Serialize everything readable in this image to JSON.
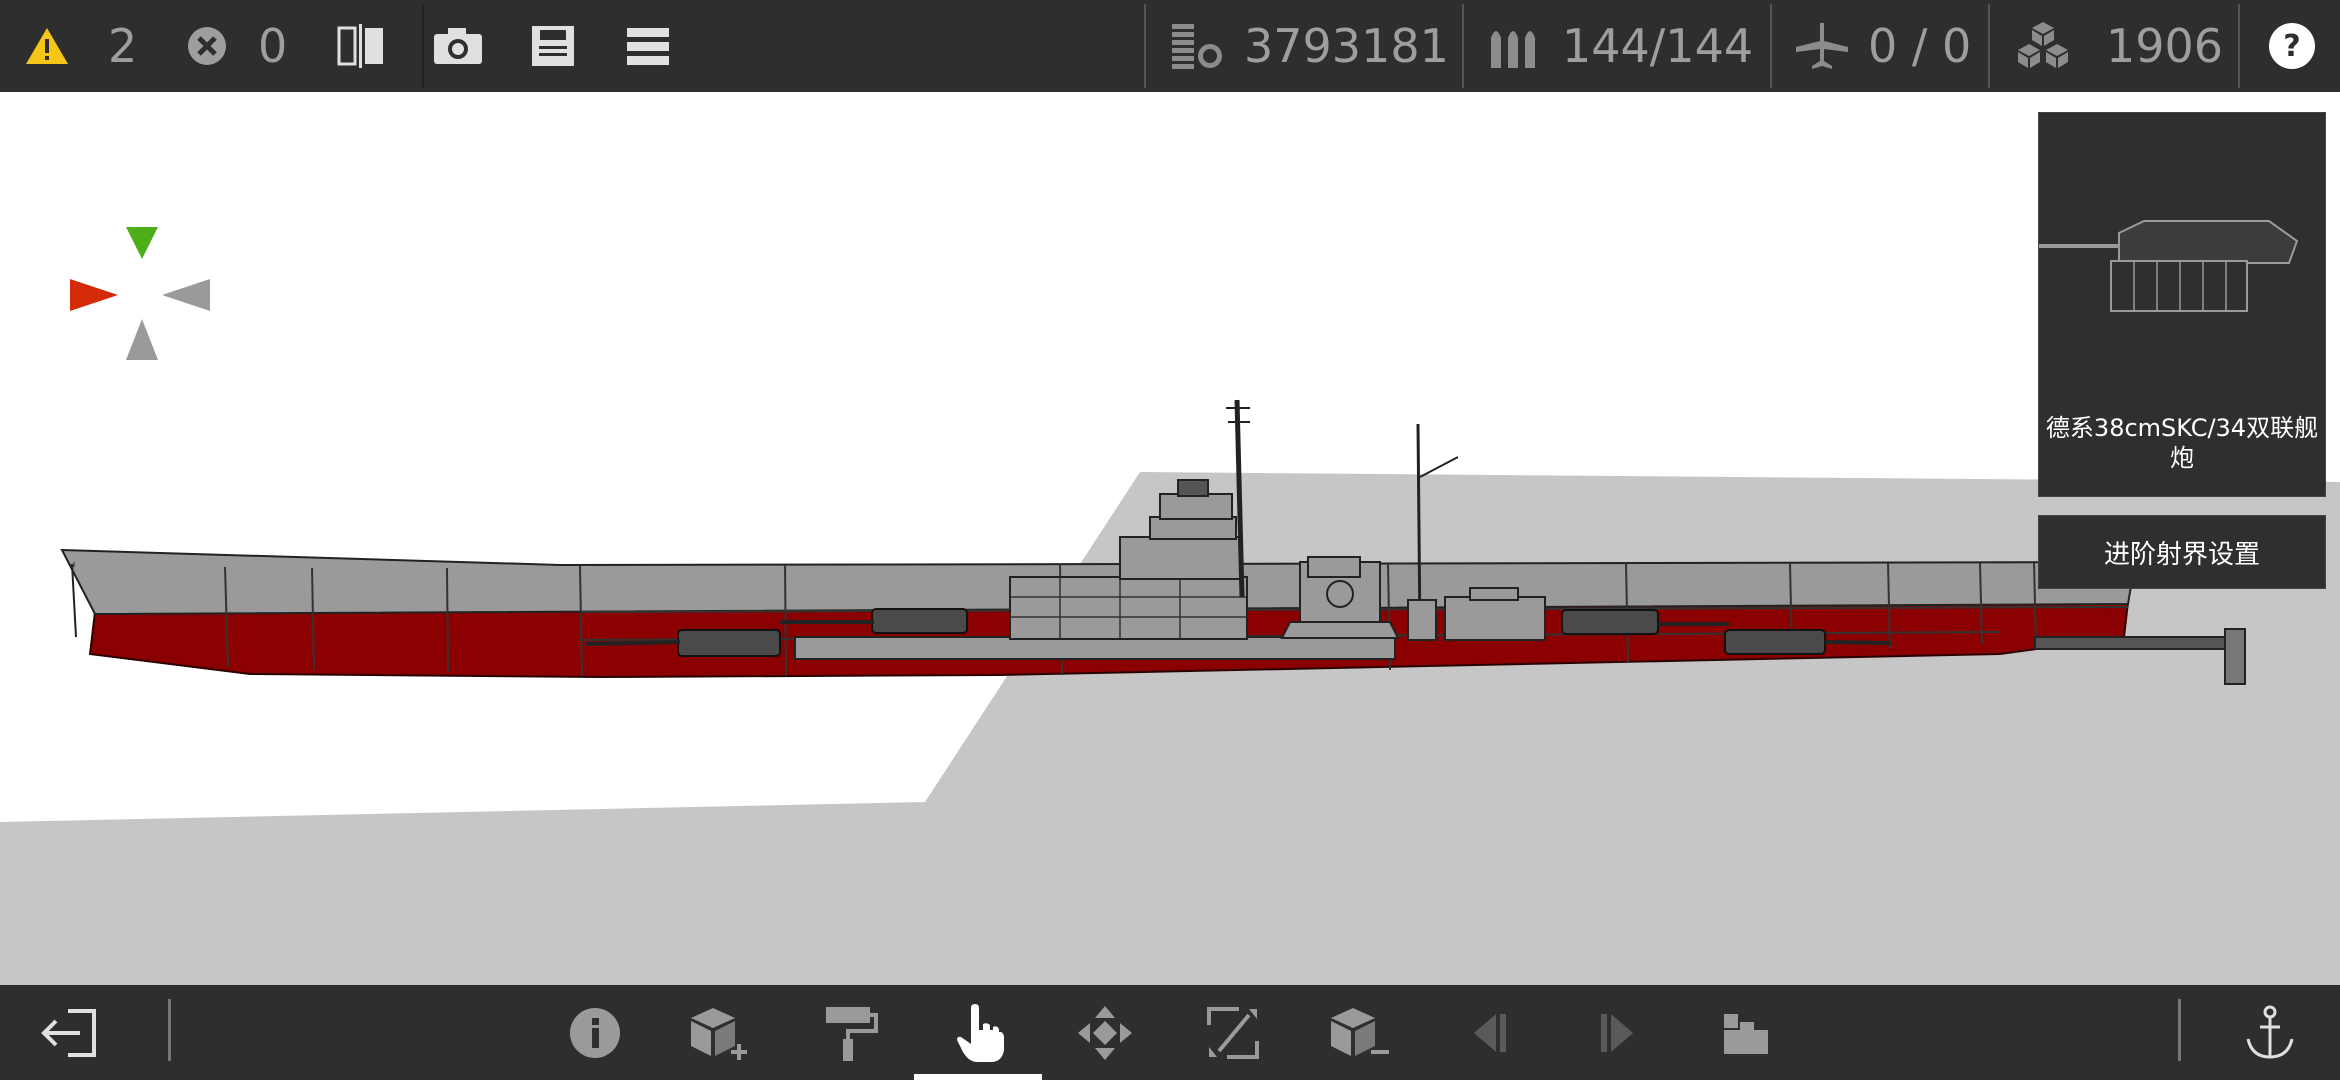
{
  "topbar": {
    "warning_count": "2",
    "error_count": "0",
    "cost": "3793181",
    "ammo": "144/144",
    "aircraft": "0 / 0",
    "parts": "1906",
    "icons": [
      "warning-icon",
      "error-icon",
      "mirror-icon",
      "camera-icon",
      "save-icon",
      "menu-icon",
      "cost-icon",
      "ammo-icon",
      "aircraft-icon",
      "parts-icon",
      "help-icon"
    ]
  },
  "part_card": {
    "name": "德系38cmSKC/34双联舰炮"
  },
  "advanced_button": {
    "label": "进阶射界设置"
  },
  "bottombar": {
    "icons": [
      "exit-icon",
      "info-icon",
      "add-part-icon",
      "paint-icon",
      "select-hand-icon",
      "move-icon",
      "rotate-icon",
      "remove-part-icon",
      "prev-icon",
      "next-icon",
      "stack-icon",
      "anchor-icon"
    ],
    "active": "select-hand-icon"
  },
  "colors": {
    "bar_bg": "#2e2e2e",
    "hull_grey": "#9a9a9a",
    "hull_red": "#8b0000",
    "warning_yellow": "#f5c518",
    "compass_green": "#4caf1a",
    "compass_red": "#d42a0a"
  }
}
